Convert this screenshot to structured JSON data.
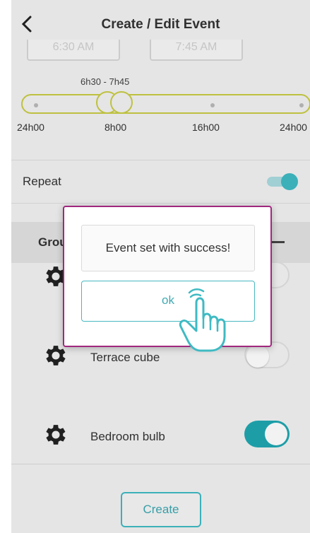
{
  "header": {
    "title": "Create / Edit Event"
  },
  "time_fields": {
    "start": "6:30 AM",
    "end": "7:45 AM"
  },
  "timeline": {
    "range_label": "6h30 - 7h45",
    "ticks": [
      "24h00",
      "8h00",
      "16h00",
      "24h00"
    ]
  },
  "repeat": {
    "label": "Repeat",
    "enabled": true
  },
  "group": {
    "title": "Group"
  },
  "devices": [
    {
      "label": "",
      "enabled": false
    },
    {
      "label": "Terrace cube",
      "enabled": false
    },
    {
      "label": "Bedroom bulb",
      "enabled": true
    }
  ],
  "create_button": "Create",
  "dialog": {
    "message": "Event set with success!",
    "ok_label": "ok"
  },
  "colors": {
    "accent": "#3fbac3",
    "dialog_border": "#a0287e",
    "timeline": "#c9cc44"
  },
  "icons": [
    "back-icon",
    "gear-icon",
    "minus-icon",
    "hand-pointer-icon"
  ]
}
